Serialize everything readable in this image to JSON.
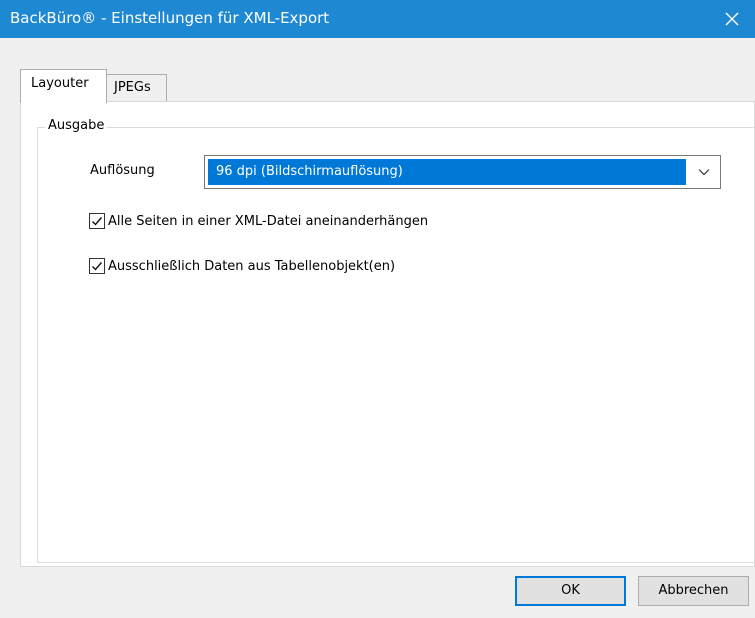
{
  "window": {
    "title": "BackBüro® - Einstellungen für XML-Export"
  },
  "tabs": [
    {
      "label": "Layouter",
      "active": true
    },
    {
      "label": "JPEGs",
      "active": false
    }
  ],
  "group": {
    "label": "Ausgabe"
  },
  "resolution": {
    "label": "Auflösung",
    "value": "96 dpi (Bildschirmauflösung)"
  },
  "options": [
    {
      "label": "Alle Seiten in einer XML-Datei aneinanderhängen",
      "checked": true
    },
    {
      "label": "Ausschließlich Daten aus Tabellenobjekt(en)",
      "checked": true
    }
  ],
  "buttons": {
    "ok": "OK",
    "cancel": "Abbrechen"
  },
  "colors": {
    "titlebar": "#1e88d3",
    "selection": "#0078d7",
    "focus_border": "#0078d7"
  },
  "icons": {
    "close": "close-icon",
    "dropdown": "chevron-down-icon",
    "check": "checkmark-icon"
  }
}
